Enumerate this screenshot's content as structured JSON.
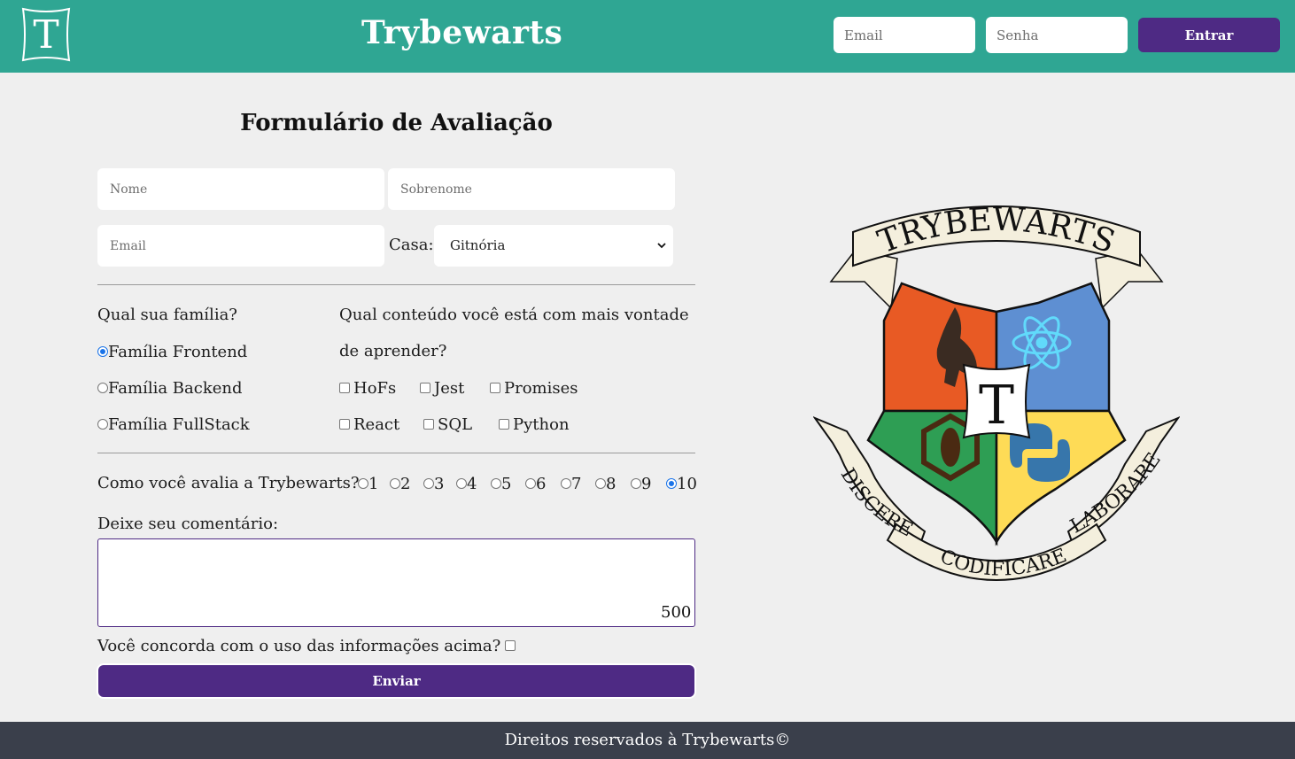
{
  "header": {
    "brand": "Trybewarts",
    "logo_letter": "T",
    "email_placeholder": "Email",
    "password_placeholder": "Senha",
    "login_label": "Entrar"
  },
  "form": {
    "title": "Formulário de Avaliação",
    "name_placeholder": "Nome",
    "lastname_placeholder": "Sobrenome",
    "email_placeholder": "Email",
    "house_label": "Casa:",
    "house_selected": "Gitnória",
    "family_question": "Qual sua família?",
    "families": [
      {
        "label": "Família Frontend",
        "checked": true
      },
      {
        "label": "Família Backend",
        "checked": false
      },
      {
        "label": "Família FullStack",
        "checked": false
      }
    ],
    "content_question_line1": "Qual conteúdo você está com mais vontade",
    "content_question_line2": "de aprender?",
    "contents": [
      {
        "label": "HoFs",
        "checked": false
      },
      {
        "label": "Jest",
        "checked": false
      },
      {
        "label": "Promises",
        "checked": false
      },
      {
        "label": "React",
        "checked": false
      },
      {
        "label": "SQL",
        "checked": false
      },
      {
        "label": "Python",
        "checked": false
      }
    ],
    "rating_question": "Como você avalia a Trybewarts?",
    "rating_options": [
      "1",
      "2",
      "3",
      "4",
      "5",
      "6",
      "7",
      "8",
      "9",
      "10"
    ],
    "rating_selected": "10",
    "comment_label": "Deixe seu comentário:",
    "comment_value": "",
    "char_counter": "500",
    "agreement_label": "Você concorda com o uso das informações acima?",
    "agreement_checked": false,
    "submit_label": "Enviar"
  },
  "crest": {
    "banner_top": "TRYBEWARTS",
    "center_letter": "T",
    "motto_left": "DISCERE",
    "motto_bottom": "CODIFICARE",
    "motto_right": "LABORARE",
    "colors": {
      "red": "#e85a24",
      "blue": "#5e8fd2",
      "green": "#2e9e54",
      "yellow": "#fedb56",
      "parchment": "#f4efdd"
    }
  },
  "footer": {
    "text": "Direitos reservados à Trybewarts©"
  },
  "colors": {
    "header_bg": "#2fa693",
    "accent_purple": "#4e2a84",
    "page_bg": "#efefef",
    "footer_bg": "#3a3f4b"
  }
}
